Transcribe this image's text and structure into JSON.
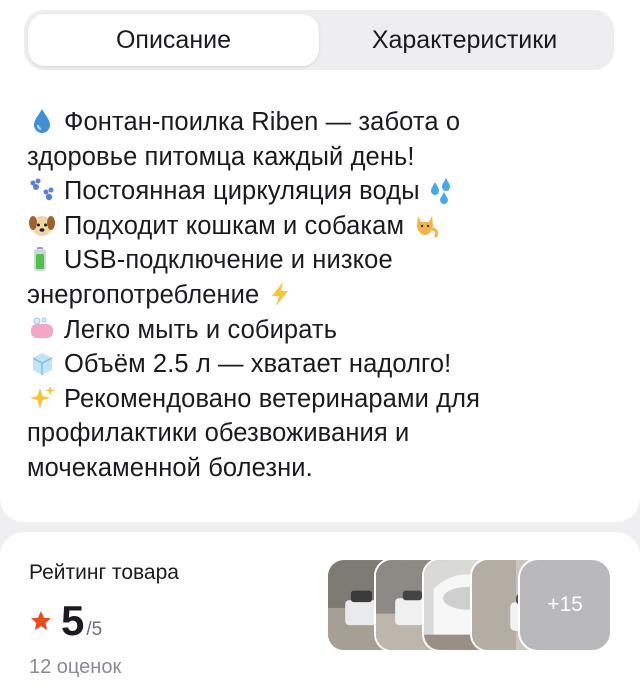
{
  "tabs": [
    {
      "label": "Описание",
      "active": true
    },
    {
      "label": "Характеристики",
      "active": false
    }
  ],
  "description": {
    "lines": [
      "Фонтан-поилка Riben — забота о",
      "здоровье питомца каждый день!",
      "Постоянная циркуляция воды",
      "Подходит кошкам и собакам",
      "USB-подключение и низкое",
      "энергопотребление",
      "Легко мыть и собирать",
      "Объём 2.5 л — хватает надолго!",
      "Рекомендовано ветеринарами для",
      "профилактики обезвоживания и",
      "мочекаменной болезни."
    ],
    "icons": [
      "droplet-icon",
      "paw-prints-icon",
      "splash-icon",
      "dog-icon",
      "cat-icon",
      "battery-icon",
      "lightning-icon",
      "soap-icon",
      "ice-cube-icon",
      "sparkles-icon"
    ]
  },
  "rating": {
    "title": "Рейтинг товара",
    "value": "5",
    "max": "/5",
    "reviews": "12 оценок",
    "star_color": "#e84d1c"
  },
  "photos": {
    "more_label": "+15"
  }
}
